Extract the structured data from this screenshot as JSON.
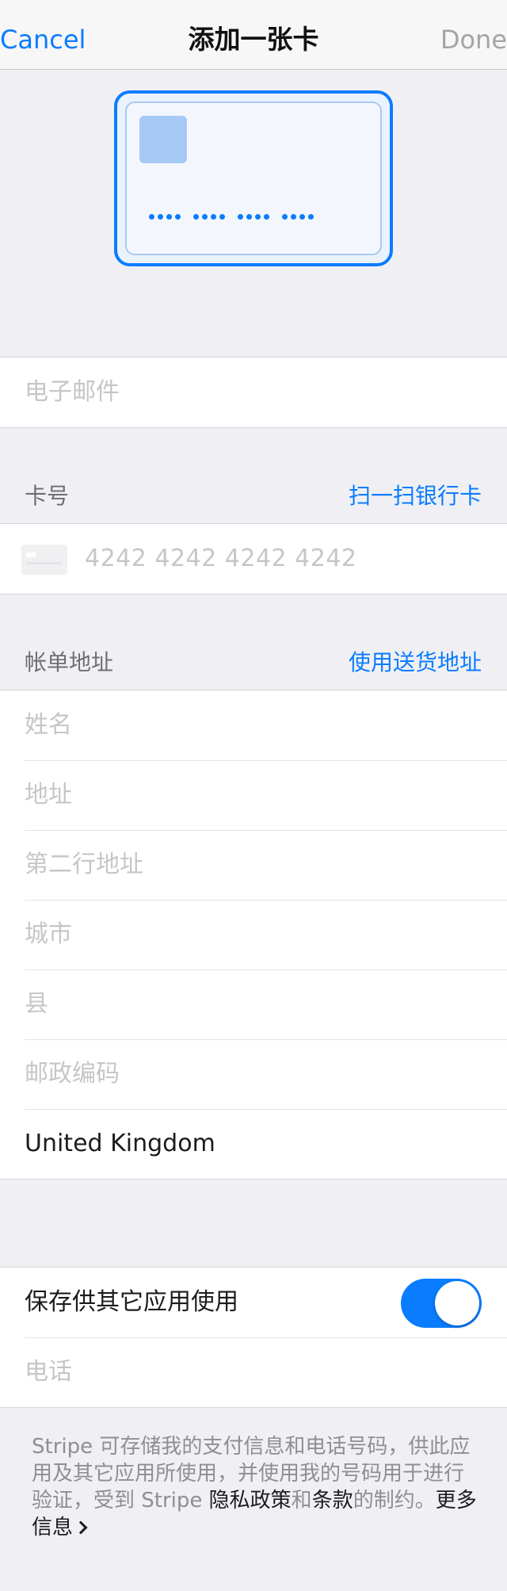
{
  "navbar": {
    "cancel": "Cancel",
    "title": "添加一张卡",
    "done": "Done"
  },
  "email": {
    "placeholder": "电子邮件"
  },
  "card_section": {
    "header": "卡号",
    "scan_link": "扫一扫银行卡",
    "number_placeholder": "4242 4242 4242 4242"
  },
  "billing_section": {
    "header": "帐单地址",
    "use_shipping_link": "使用送货地址",
    "fields": {
      "name": "姓名",
      "address": "地址",
      "address2": "第二行地址",
      "city": "城市",
      "county": "县",
      "postcode": "邮政编码"
    },
    "country": "United Kingdom"
  },
  "save_section": {
    "toggle_label": "保存供其它应用使用",
    "toggle_on": true,
    "phone_placeholder": "电话"
  },
  "footer": {
    "text_1": "Stripe 可存储我的支付信息和电话号码，供此应用及其它应用所使用，并使用我的号码用于进行验证，受到 Stripe ",
    "privacy_link": "隐私政策",
    "text_2": "和",
    "terms_link": "条款",
    "text_3": "的制约。",
    "more_info_link": "更多信息"
  },
  "colors": {
    "accent": "#0a7cff",
    "background": "#f0f0f4",
    "placeholder": "#c6c6ca"
  }
}
